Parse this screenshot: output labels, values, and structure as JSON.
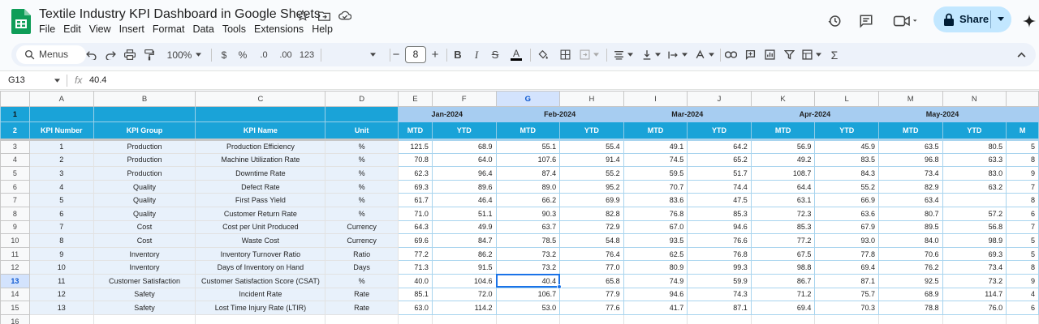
{
  "doc": {
    "title": "Textile Industry KPI Dashboard in Google Sheets"
  },
  "menu": [
    "File",
    "Edit",
    "View",
    "Insert",
    "Format",
    "Data",
    "Tools",
    "Extensions",
    "Help"
  ],
  "share": {
    "label": "Share"
  },
  "toolbar": {
    "menus_label": "Menus",
    "zoom": "100%",
    "currency": "$",
    "percent": "%",
    "dec_less": ".0",
    "dec_more": ".00",
    "format_123": "123",
    "font_size": "8"
  },
  "formula": {
    "cell": "G13",
    "value": "40.4"
  },
  "grid": {
    "columns": [
      "A",
      "B",
      "C",
      "D",
      "E",
      "F",
      "G",
      "H",
      "I",
      "J",
      "K",
      "L",
      "M",
      "N"
    ],
    "selected_col": "G",
    "months": [
      "Jan-2024",
      "Feb-2024",
      "Mar-2024",
      "Apr-2024",
      "May-2024"
    ],
    "headers": {
      "kpi_number": "KPI Number",
      "kpi_group": "KPI Group",
      "kpi_name": "KPI Name",
      "unit": "Unit",
      "mtd": "MTD",
      "ytd": "YTD",
      "partial": "M"
    },
    "row_numbers": [
      "1",
      "2",
      "3",
      "4",
      "5",
      "6",
      "7",
      "8",
      "9",
      "10",
      "11",
      "12",
      "13",
      "14",
      "15",
      "16"
    ],
    "selected_row": "13",
    "rows": [
      {
        "num": "1",
        "group": "Production",
        "name": "Production Efficiency",
        "unit": "%",
        "vals": [
          "121.5",
          "68.9",
          "55.1",
          "55.4",
          "49.1",
          "64.2",
          "56.9",
          "45.9",
          "63.5",
          "80.5"
        ],
        "edge": "5"
      },
      {
        "num": "2",
        "group": "Production",
        "name": "Machine Utilization Rate",
        "unit": "%",
        "vals": [
          "70.8",
          "64.0",
          "107.6",
          "91.4",
          "74.5",
          "65.2",
          "49.2",
          "83.5",
          "96.8",
          "63.3"
        ],
        "edge": "8"
      },
      {
        "num": "3",
        "group": "Production",
        "name": "Downtime Rate",
        "unit": "%",
        "vals": [
          "62.3",
          "96.4",
          "87.4",
          "55.2",
          "59.5",
          "51.7",
          "108.7",
          "84.3",
          "73.4",
          "83.0"
        ],
        "edge": "9"
      },
      {
        "num": "4",
        "group": "Quality",
        "name": "Defect Rate",
        "unit": "%",
        "vals": [
          "69.3",
          "89.6",
          "89.0",
          "95.2",
          "70.7",
          "74.4",
          "64.4",
          "55.2",
          "82.9",
          "63.2"
        ],
        "edge": "7"
      },
      {
        "num": "5",
        "group": "Quality",
        "name": "First Pass Yield",
        "unit": "%",
        "vals": [
          "61.7",
          "46.4",
          "66.2",
          "69.9",
          "83.6",
          "47.5",
          "63.1",
          "66.9",
          "63.4"
        ],
        "edge": "8"
      },
      {
        "num": "6",
        "group": "Quality",
        "name": "Customer Return Rate",
        "unit": "%",
        "vals": [
          "71.0",
          "51.1",
          "90.3",
          "82.8",
          "76.8",
          "85.3",
          "72.3",
          "63.6",
          "80.7",
          "57.2"
        ],
        "edge": "6"
      },
      {
        "num": "7",
        "group": "Cost",
        "name": "Cost per Unit Produced",
        "unit": "Currency",
        "vals": [
          "64.3",
          "49.9",
          "63.7",
          "72.9",
          "67.0",
          "94.6",
          "85.3",
          "67.9",
          "89.5",
          "56.8"
        ],
        "edge": "7"
      },
      {
        "num": "8",
        "group": "Cost",
        "name": "Waste Cost",
        "unit": "Currency",
        "vals": [
          "69.6",
          "84.7",
          "78.5",
          "54.8",
          "93.5",
          "76.6",
          "77.2",
          "93.0",
          "84.0",
          "98.9"
        ],
        "edge": "5"
      },
      {
        "num": "9",
        "group": "Inventory",
        "name": "Inventory Turnover Ratio",
        "unit": "Ratio",
        "vals": [
          "77.2",
          "86.2",
          "73.2",
          "76.4",
          "62.5",
          "76.8",
          "67.5",
          "77.8",
          "70.6",
          "69.3"
        ],
        "edge": "5"
      },
      {
        "num": "10",
        "group": "Inventory",
        "name": "Days of Inventory on Hand",
        "unit": "Days",
        "vals": [
          "71.3",
          "91.5",
          "73.2",
          "77.0",
          "80.9",
          "99.3",
          "98.8",
          "69.4",
          "76.2",
          "73.4"
        ],
        "edge": "8"
      },
      {
        "num": "11",
        "group": "Customer Satisfaction",
        "name": "Customer Satisfaction Score (CSAT)",
        "unit": "%",
        "vals": [
          "40.0",
          "104.6",
          "40.4",
          "65.8",
          "74.9",
          "59.9",
          "86.7",
          "87.1",
          "92.5",
          "73.2"
        ],
        "edge": "9"
      },
      {
        "num": "12",
        "group": "Safety",
        "name": "Incident Rate",
        "unit": "Rate",
        "vals": [
          "85.1",
          "72.0",
          "106.7",
          "77.9",
          "94.6",
          "74.3",
          "71.2",
          "75.7",
          "68.9",
          "114.7"
        ],
        "edge": "4"
      },
      {
        "num": "13",
        "group": "Safety",
        "name": "Lost Time Injury Rate (LTIR)",
        "unit": "Rate",
        "vals": [
          "63.0",
          "114.2",
          "53.0",
          "77.6",
          "41.7",
          "87.1",
          "69.4",
          "70.3",
          "78.8",
          "76.0"
        ],
        "edge": "6"
      }
    ]
  },
  "colors": {
    "header_blue": "#1aa3d8",
    "month_band": "#a7cdf1",
    "info_fill": "#e8f1fb",
    "selection": "#1a73e8",
    "share_bg": "#c2e7ff"
  }
}
